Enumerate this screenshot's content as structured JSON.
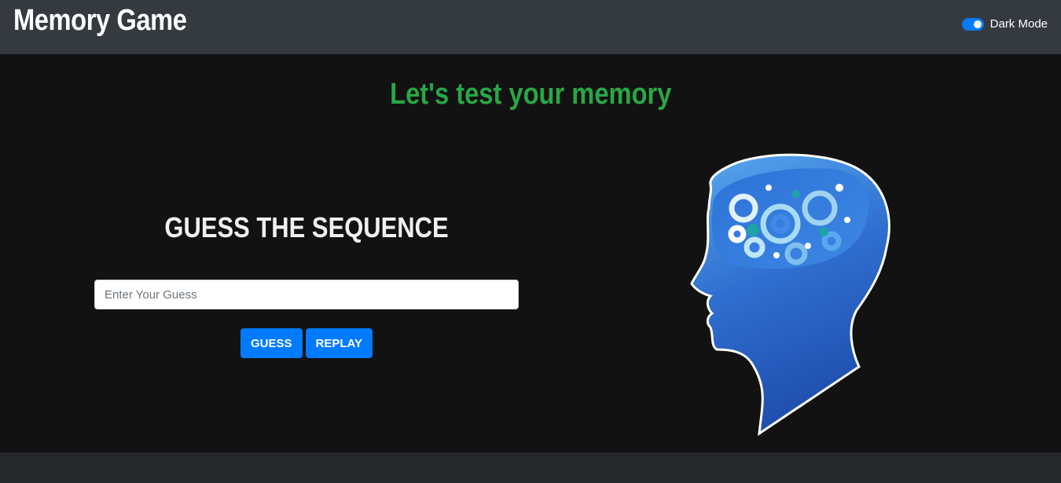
{
  "navbar": {
    "brand": "Memory Game",
    "dark_mode_label": "Dark Mode",
    "dark_mode_on": true
  },
  "main": {
    "headline": "Let's test your memory",
    "guess_title": "GUESS THE SEQUENCE",
    "input_placeholder": "Enter Your Guess",
    "input_value": "",
    "guess_button": "GUESS",
    "replay_button": "REPLAY"
  },
  "illustration": {
    "icon": "brain-gears-head-icon"
  },
  "colors": {
    "navbar_bg": "#343a40",
    "page_bg": "#121212",
    "headline_green": "#28a745",
    "button_blue": "#007bff",
    "footer_bg": "#25272b"
  }
}
